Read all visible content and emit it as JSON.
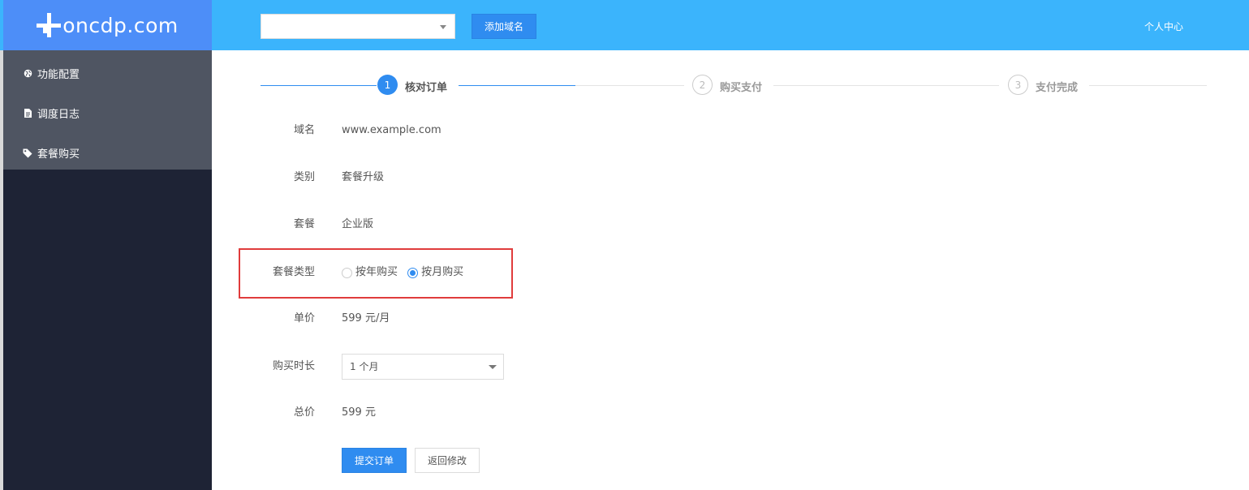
{
  "brand": {
    "logo_text": "oncdp.com"
  },
  "header": {
    "domain_select_value": "",
    "add_domain_label": "添加域名",
    "user_center_label": "个人中心"
  },
  "sidebar": {
    "items": [
      {
        "label": "功能配置",
        "icon": "globe-icon"
      },
      {
        "label": "调度日志",
        "icon": "document-icon"
      },
      {
        "label": "套餐购买",
        "icon": "tag-icon"
      }
    ]
  },
  "steps": [
    {
      "num": "1",
      "label": "核对订单",
      "state": "active"
    },
    {
      "num": "2",
      "label": "购买支付",
      "state": "inactive"
    },
    {
      "num": "3",
      "label": "支付完成",
      "state": "inactive"
    }
  ],
  "form": {
    "domain": {
      "label": "域名",
      "value": "www.example.com"
    },
    "category": {
      "label": "类别",
      "value": "套餐升级"
    },
    "package": {
      "label": "套餐",
      "value": "企业版"
    },
    "package_type": {
      "label": "套餐类型",
      "options": [
        {
          "label": "按年购买",
          "checked": false
        },
        {
          "label": "按月购买",
          "checked": true
        }
      ]
    },
    "unit_price": {
      "label": "单价",
      "value": "599 元/月"
    },
    "duration": {
      "label": "购买时长",
      "value": "1 个月"
    },
    "total": {
      "label": "总价",
      "value": "599 元"
    }
  },
  "actions": {
    "submit_label": "提交订单",
    "back_label": "返回修改"
  },
  "colors": {
    "topbar": "#3bb4fc",
    "logo_bg": "#4d8ef8",
    "primary": "#2f8cf0",
    "sidebar_bg": "#1e2335",
    "sidebar_menu_bg": "#4f5562",
    "highlight": "#e03c3c"
  }
}
